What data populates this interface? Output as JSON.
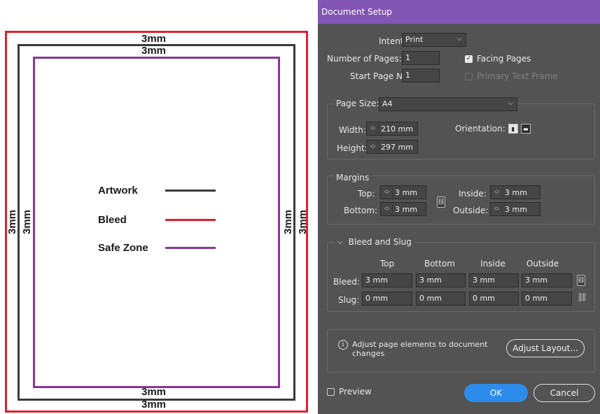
{
  "diagram": {
    "top_outer": "3mm",
    "top_inner": "3mm",
    "bottom_inner": "3mm",
    "bottom_outer": "3mm",
    "left_outer": "3mm",
    "left_inner": "3mm",
    "right_inner": "3mm",
    "right_outer": "3mm",
    "legend": [
      {
        "label": "Artwork",
        "color": "#3a3a3a"
      },
      {
        "label": "Bleed",
        "color": "#e02030"
      },
      {
        "label": "Safe Zone",
        "color": "#8a3596"
      }
    ]
  },
  "dialog": {
    "title": "Document Setup",
    "intent": {
      "label": "Intent:",
      "value": "Print"
    },
    "num_pages": {
      "label": "Number of Pages:",
      "value": "1"
    },
    "start_page": {
      "label": "Start Page №:",
      "value": "1"
    },
    "facing_pages": {
      "label": "Facing Pages",
      "checked": true
    },
    "primary_text_frame": {
      "label": "Primary Text Frame",
      "checked": false
    },
    "page_size": {
      "label": "Page Size:",
      "value": "A4"
    },
    "width": {
      "label": "Width:",
      "value": "210 mm"
    },
    "height": {
      "label": "Height:",
      "value": "297 mm"
    },
    "orientation": {
      "label": "Orientation:"
    },
    "margins": {
      "title": "Margins",
      "top": {
        "label": "Top:",
        "value": "3 mm"
      },
      "bottom": {
        "label": "Bottom:",
        "value": "3 mm"
      },
      "inside": {
        "label": "Inside:",
        "value": "3 mm"
      },
      "outside": {
        "label": "Outside:",
        "value": "3 mm"
      }
    },
    "bleed_slug": {
      "title": "Bleed and Slug",
      "columns": [
        "Top",
        "Bottom",
        "Inside",
        "Outside"
      ],
      "bleed": {
        "label": "Bleed:",
        "values": [
          "3 mm",
          "3 mm",
          "3 mm",
          "3 mm"
        ]
      },
      "slug": {
        "label": "Slug:",
        "values": [
          "0 mm",
          "0 mm",
          "0 mm",
          "0 mm"
        ]
      }
    },
    "info": {
      "text": "Adjust page elements to document changes"
    },
    "adjust_layout": "Adjust Layout...",
    "preview": {
      "label": "Preview",
      "checked": false
    },
    "ok": "OK",
    "cancel": "Cancel",
    "colors": {
      "title_bar": "#8256b4",
      "background": "#535353",
      "ok_button": "#2d8ceb"
    }
  }
}
